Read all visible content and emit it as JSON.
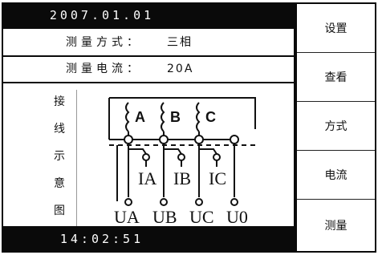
{
  "status": {
    "date": "2007.01.01",
    "time": "14:02:51"
  },
  "fields": [
    {
      "label": "测量方式：",
      "value": "三相"
    },
    {
      "label": "测量电流：",
      "value": "20A"
    }
  ],
  "diagram": {
    "side_label_chars": [
      "接",
      "线",
      "示",
      "意",
      "图"
    ],
    "phase_labels": [
      "A",
      "B",
      "C"
    ],
    "current_labels": [
      "IA",
      "IB",
      "IC"
    ],
    "voltage_labels": [
      "UA",
      "UB",
      "UC",
      "U0"
    ]
  },
  "menu": {
    "items": [
      "设置",
      "查看",
      "方式",
      "电流",
      "测量"
    ]
  }
}
